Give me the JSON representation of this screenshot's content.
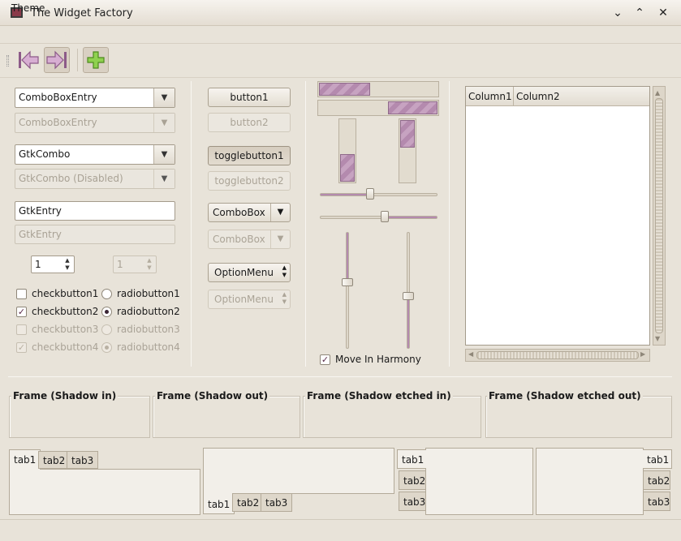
{
  "window": {
    "title": "The Widget Factory",
    "minimize_glyph": "⌄",
    "maximize_glyph": "⌃",
    "close_glyph": "✕"
  },
  "menubar": {
    "items": [
      "Theme"
    ]
  },
  "toolbar": {
    "icons": [
      "back-icon",
      "forward-icon",
      "add-icon"
    ]
  },
  "column1": {
    "combo_entry": "ComboBoxEntry",
    "combo_entry_disabled": "ComboBoxEntry",
    "gtk_combo": "GtkCombo",
    "gtk_combo_disabled": "GtkCombo (Disabled)",
    "entry": "GtkEntry",
    "entry_disabled": "GtkEntry",
    "spin_value": "1",
    "spin_disabled_value": "1",
    "checkbuttons": [
      {
        "label": "checkbutton1",
        "checked": false,
        "disabled": false
      },
      {
        "label": "checkbutton2",
        "checked": true,
        "disabled": false
      },
      {
        "label": "checkbutton3",
        "checked": false,
        "disabled": true
      },
      {
        "label": "checkbutton4",
        "checked": true,
        "disabled": true
      }
    ],
    "radiobuttons": [
      {
        "label": "radiobutton1",
        "selected": false,
        "disabled": false
      },
      {
        "label": "radiobutton2",
        "selected": true,
        "disabled": false
      },
      {
        "label": "radiobutton3",
        "selected": false,
        "disabled": true
      },
      {
        "label": "radiobutton4",
        "selected": true,
        "disabled": true
      }
    ]
  },
  "column2": {
    "button1": "button1",
    "button2": "button2",
    "toggle1": "togglebutton1",
    "toggle2": "togglebutton2",
    "combobox": "ComboBox",
    "combobox_disabled": "ComboBox",
    "optionmenu": "OptionMenu",
    "optionmenu_disabled": "OptionMenu"
  },
  "column3": {
    "progress_h1": 0.43,
    "progress_h2_start": 0.58,
    "progress_v1_fill": 0.45,
    "progress_v2_fill": 0.45,
    "hscale1_value": 0.43,
    "hscale2_value": 0.55,
    "vscale1_value": 0.43,
    "vscale2_value": 0.55,
    "move_in_harmony": "Move In Harmony",
    "move_in_harmony_checked": true
  },
  "treeview": {
    "columns": [
      "Column1",
      "Column2"
    ]
  },
  "frames": [
    "Frame (Shadow in)",
    "Frame (Shadow out)",
    "Frame (Shadow etched in)",
    "Frame (Shadow etched out)"
  ],
  "notebooks": {
    "top": [
      "tab1",
      "tab2",
      "tab3"
    ],
    "bottom": [
      "tab1",
      "tab2",
      "tab3"
    ],
    "left": [
      "tab1",
      "tab2",
      "tab3"
    ],
    "right": [
      "tab1",
      "tab2",
      "tab3"
    ]
  },
  "colors": {
    "accent": "#b48aae",
    "background": "#e8e3d9"
  }
}
